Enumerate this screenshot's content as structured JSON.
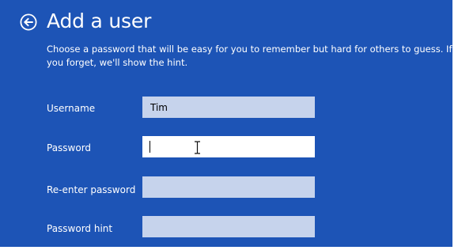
{
  "header": {
    "title": "Add a user",
    "back_icon": "back-arrow-icon"
  },
  "description": "Choose a password that will be easy for you to remember but hard for others to guess. If you forget, we'll show the hint.",
  "form": {
    "username": {
      "label": "Username",
      "value": "Tim"
    },
    "password": {
      "label": "Password",
      "value": "",
      "focused": true
    },
    "reenter_password": {
      "label": "Re-enter password",
      "value": ""
    },
    "password_hint": {
      "label": "Password hint",
      "value": ""
    }
  },
  "colors": {
    "background": "#1d54b6",
    "field": "#c6d3ec",
    "field_focused": "#ffffff",
    "text": "#ffffff"
  }
}
